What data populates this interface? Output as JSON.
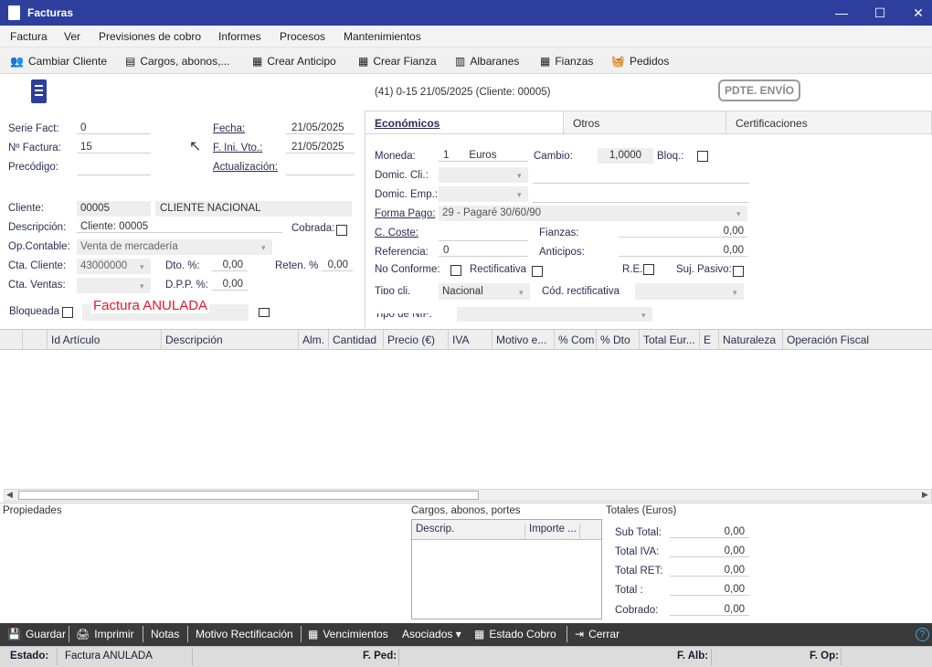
{
  "window": {
    "title": "Facturas",
    "min": "—",
    "max": "☐",
    "close": "✕"
  },
  "menu": [
    "Factura",
    "Ver",
    "Previsiones de cobro",
    "Informes",
    "Procesos",
    "Mantenimientos"
  ],
  "toolbar": [
    "Cambiar Cliente",
    "Cargos, abonos,...",
    "Crear Anticipo",
    "Crear Fianza",
    "Albaranes",
    "Fianzas",
    "Pedidos"
  ],
  "header": {
    "summary": "(41) 0-15  21/05/2025  (Cliente: 00005)",
    "stamp": "PDTE. ENVÍO",
    "annul": "Factura ANULADA"
  },
  "form": {
    "serie_label": "Serie Fact:",
    "serie_value": "0",
    "numero_label": "Nº Factura:",
    "numero_value": "15",
    "precodigo_label": "Precódigo:",
    "fecha_label": "Fecha:",
    "fecha_value": "21/05/2025",
    "fini_label": "F. Ini. Vto.:",
    "fini_value": "21/05/2025",
    "actualizacion_label": "Actualización:",
    "cliente_label": "Cliente:",
    "cliente_code": "00005",
    "cliente_name": "CLIENTE NACIONAL",
    "descripcion_label": "Descripción:",
    "descripcion_value": "Cliente: 00005",
    "cobrada_label": "Cobrada:",
    "opcontable_label": "Op.Contable:",
    "opcontable_value": "Venta de mercadería",
    "ctacliente_label": "Cta. Cliente:",
    "ctacliente_value": "43000000",
    "dto_label": "Dto. %:",
    "dto_value": "0,00",
    "reten_label": "Reten. %",
    "reten_value": "0,00",
    "ctaventas_label": "Cta. Ventas:",
    "dpp_label": "D.P.P. %:",
    "dpp_value": "0,00",
    "bloqueada_label": "Bloqueada"
  },
  "tabs": [
    "Económicos",
    "Otros",
    "Certificaciones"
  ],
  "economicos": {
    "moneda_label": "Moneda:",
    "moneda_code": "1",
    "moneda_name": "Euros",
    "cambio_label": "Cambio:",
    "cambio_value": "1,0000",
    "bloq_label": "Bloq.:",
    "domcli_label": "Domic. Cli.:",
    "domemp_label": "Domic. Emp.:",
    "formapago_label": "Forma Pago:",
    "formapago_value": "29 - Pagaré 30/60/90",
    "ccoste_label": "C. Coste:",
    "fianzas_label": "Fianzas:",
    "fianzas_value": "0,00",
    "referencia_label": "Referencia:",
    "referencia_value": "0",
    "anticipos_label": "Anticipos:",
    "anticipos_value": "0,00",
    "noconforme_label": "No Conforme:",
    "rectificativa_label": "Rectificativa",
    "re_label": "R.E.:",
    "sujpasivo_label": "Suj. Pasivo:",
    "tipocli_label": "Tipo cli.",
    "tipocli_value": "Nacional",
    "codrect_label": "Cód. rectificativa",
    "tiponif_label": "Tipo de NIF:"
  },
  "grid_columns": [
    "Id Artículo",
    "Descripción",
    "Alm.",
    "Cantidad",
    "Precio (€)",
    "IVA",
    "Motivo e...",
    "% Com",
    "% Dto",
    "Total Eur...",
    "E",
    "Naturaleza",
    "Operación Fiscal"
  ],
  "bottom": {
    "propiedades": "Propiedades",
    "cargos_title": "Cargos, abonos, portes",
    "cargos_cols": [
      "Descrip.",
      "Importe ..."
    ],
    "totales_title": "Totales (Euros)",
    "subtotal_label": "Sub Total:",
    "subtotal_value": "0,00",
    "totaliva_label": "Total IVA:",
    "totaliva_value": "0,00",
    "totalret_label": "Total RET:",
    "totalret_value": "0,00",
    "total_label": "Total :",
    "total_value": "0,00",
    "cobrado_label": "Cobrado:",
    "cobrado_value": "0,00"
  },
  "actions": [
    "Guardar",
    "Imprimir",
    "Notas",
    "Motivo Rectificación",
    "Vencimientos",
    "Asociados ▾",
    "Estado Cobro",
    "Cerrar"
  ],
  "status": {
    "estado_label": "Estado:",
    "estado_value": "Factura ANULADA",
    "fped_label": "F. Ped:",
    "falb_label": "F. Alb:",
    "fop_label": "F. Op:"
  }
}
